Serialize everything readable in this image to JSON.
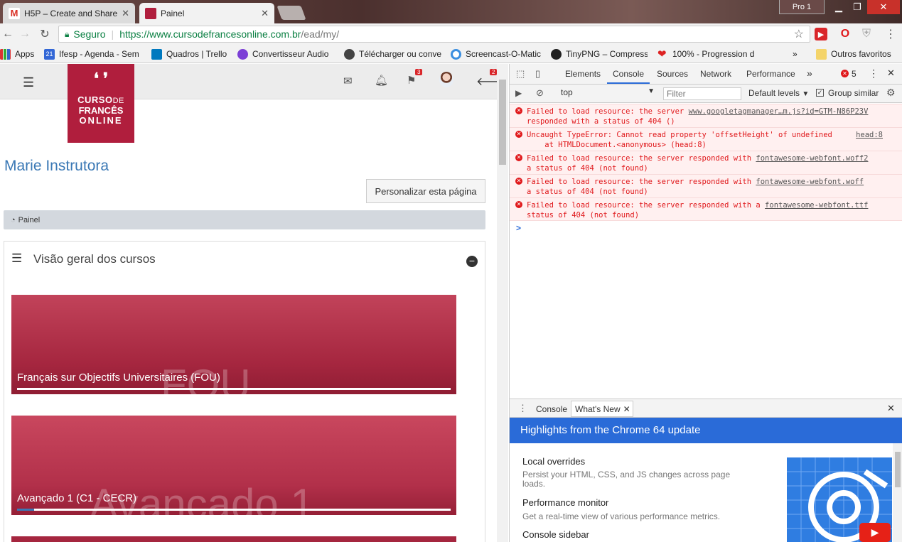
{
  "browser": {
    "tabs": [
      {
        "title": "H5P – Create and Share",
        "active": false,
        "favicon": "gmail-icon"
      },
      {
        "title": "Painel",
        "active": true,
        "favicon": "cursodefrances-icon"
      }
    ],
    "profile_label": "Pro 1",
    "security_label": "Seguro",
    "url_host": "https://www.cursodefrancesonline.com.br",
    "url_path": "/ead/my/",
    "bookmarks": [
      "Apps",
      "Ifesp - Agenda - Sem",
      "Quadros | Trello",
      "Convertisseur Audio",
      "Télécharger ou conve",
      "Screencast-O-Matic",
      "TinyPNG – Compress",
      "100% - Progression d"
    ],
    "other_bookmarks": "Outros favoritos",
    "calendar_day": "21"
  },
  "site": {
    "logo": {
      "line1": "CURSO",
      "line1b": "DE",
      "line2": "FRANCÊS",
      "line3": "ONLINE"
    },
    "flag_badge": "3",
    "arrow_badge": "2",
    "user_name": "Marie Instrutora",
    "customize_button": "Personalizar esta página",
    "breadcrumb": "Painel",
    "block_title": "Visão geral dos cursos",
    "courses": [
      {
        "title": "Français sur Objectifs Universitaires (FOU)",
        "bg_text": "FOU",
        "progress": 0
      },
      {
        "title": "Avançado 1 (C1 - CECR)",
        "bg_text": "Avançado 1",
        "progress": 0.04
      }
    ]
  },
  "devtools": {
    "tabs": [
      "Elements",
      "Console",
      "Sources",
      "Network",
      "Performance"
    ],
    "active_tab": "Console",
    "error_count": "5",
    "context": "top",
    "filter_placeholder": "Filter",
    "levels": "Default levels",
    "group_similar": "Group similar",
    "errors": [
      {
        "l1": "Failed to load resource: the server ",
        "link": "www.googletagmanager…m.js?id=GTM-N86P23V",
        "l2": "responded with a status of 404 ()"
      },
      {
        "l1": "Uncaught TypeError: Cannot read property 'offsetHeight' of undefined",
        "link": "head:8",
        "l2": "    at HTMLDocument.<anonymous> (head:8)"
      },
      {
        "l1": "Failed to load resource: the server responded with ",
        "link": "fontawesome-webfont.woff2",
        "l2": "a status of 404 (not found)"
      },
      {
        "l1": "Failed to load resource: the server responded with ",
        "link": "fontawesome-webfont.woff",
        "l2": "a status of 404 (not found)"
      },
      {
        "l1": "Failed to load resource: the server responded with a ",
        "link": "fontawesome-webfont.ttf",
        "l2": "status of 404 (not found)"
      }
    ],
    "prompt": ">",
    "drawer_tabs": [
      "Console",
      "What's New"
    ],
    "banner": "Highlights from the Chrome 64 update",
    "news": [
      {
        "title": "Local overrides",
        "desc": "Persist your HTML, CSS, and JS changes across page loads."
      },
      {
        "title": "Performance monitor",
        "desc": "Get a real-time view of various performance metrics."
      },
      {
        "title": "Console sidebar",
        "desc": ""
      }
    ]
  },
  "colors": {
    "brand": "#b01e3d",
    "link_blue": "#3a78b5",
    "devtools_blue": "#2a6bd8",
    "error_red": "#e0181b"
  }
}
